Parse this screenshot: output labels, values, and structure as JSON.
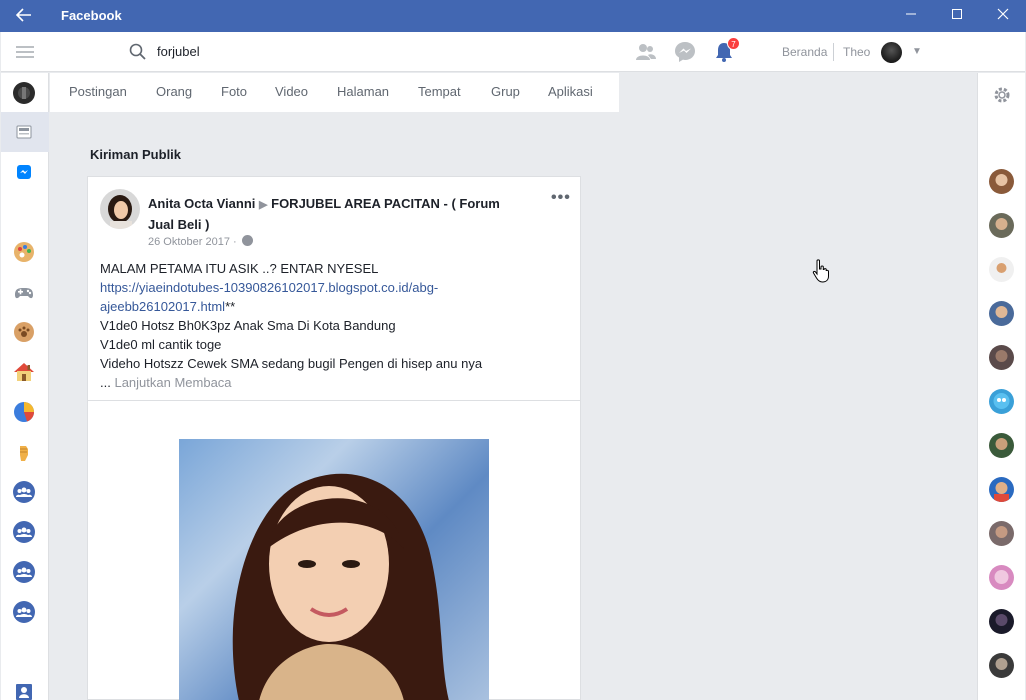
{
  "window": {
    "title": "Facebook",
    "back_icon": "back-arrow-icon",
    "minimize_icon": "minimize-icon",
    "maximize_icon": "maximize-icon",
    "close_icon": "close-icon"
  },
  "topbar": {
    "search_value": "forjubel",
    "notification_count": "7",
    "home_label": "Beranda",
    "user_name": "Theo",
    "icons": [
      "menu-icon",
      "search-icon",
      "friends-icon",
      "messenger-icon",
      "notifications-icon",
      "chevron-down-icon"
    ]
  },
  "tabs": [
    "Postingan",
    "Orang",
    "Foto",
    "Video",
    "Halaman",
    "Tempat",
    "Grup",
    "Aplikasi"
  ],
  "left_rail": {
    "items": [
      "profile-avatar",
      "news-feed-icon",
      "messenger-icon",
      "palette-icon",
      "gamepad-icon",
      "paw-icon",
      "house-icon",
      "pie-chart-icon",
      "fist-icon",
      "group-icon",
      "group-icon",
      "group-icon",
      "group-icon",
      "contact-icon"
    ]
  },
  "section": {
    "title": "Kiriman Publik"
  },
  "post": {
    "author": "Anita Octa Vianni",
    "group": "FORJUBEL  AREA  PACITAN - ( Forum Jual Beli )",
    "date": "26 Oktober 2017",
    "date_sep": "·",
    "lines": [
      "MALAM PETAMA ITU ASIK ..? ENTAR NYESEL",
      "V1de0 Hotsz Bh0K3pz Anak Sma Di Kota Bandung",
      "V1de0 ml cantik toge",
      "Videho Hotszz Cewek SMA sedang bugil Pengen di hisep anu nya"
    ],
    "link_line1": "https://yiaeindotubes-10390826102017.blogspot.co.id/abg-",
    "link_line2": "ajeebb26102017.html",
    "link_suffix": "**",
    "ellipsis": "...",
    "read_more": "Lanjutkan Membaca",
    "more_icon": "•••"
  },
  "right_rail": {
    "settings_icon": "gear-icon",
    "friend_count": 12
  },
  "colors": {
    "brand": "#4267b2",
    "link": "#365899",
    "badge": "#fa3e3e",
    "background": "#e9ebee"
  }
}
